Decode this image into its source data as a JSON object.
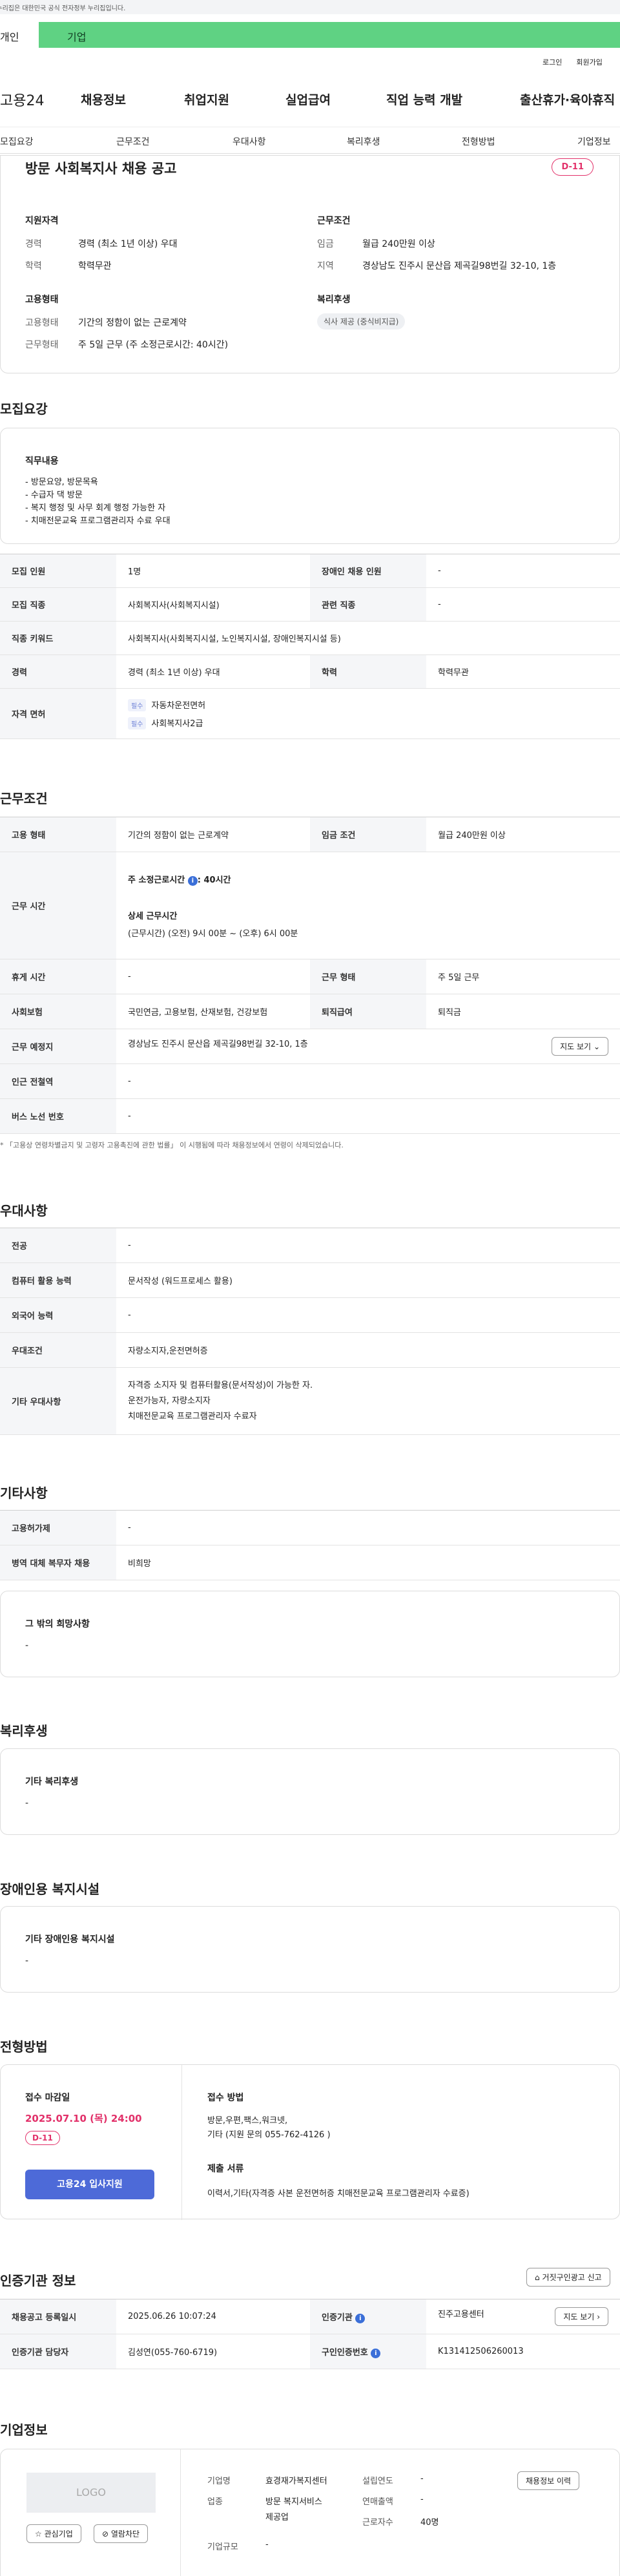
{
  "topbar": {
    "notice": "이 누리집은 대한민국 공식 전자정부 누리집입니다."
  },
  "site_tabs": {
    "personal": "개인",
    "corporate": "기업"
  },
  "util": {
    "login": "로그인",
    "join": "회원가입"
  },
  "gnb": {
    "logo": "고용24",
    "items": [
      "채용정보",
      "취업지원",
      "실업급여",
      "직업 능력 개발",
      "출산휴가·육아휴직"
    ]
  },
  "lnb": {
    "items": [
      "모집요강",
      "근무조건",
      "우대사항",
      "복리후생",
      "전형방법",
      "기업정보"
    ]
  },
  "header": {
    "title": "방문 사회복지사 채용 공고",
    "dday": "D-11",
    "qual_title": "지원자격",
    "career_label": "경력",
    "career_value": "경력 (최소 1년 이상) 우대",
    "edu_label": "학력",
    "edu_value": "학력무관",
    "emp_title": "고용형태",
    "emp_label": "고용형태",
    "emp_value": "기간의 정함이 없는 근로계약",
    "work_label": "근무형태",
    "work_value": "주 5일 근무 (주 소정근로시간: 40시간)",
    "cond_title": "근무조건",
    "wage_label": "임금",
    "wage_value": "월급 240만원 이상",
    "region_label": "지역",
    "region_value": "경상남도 진주시 문산읍 제곡길98번길 32-10, 1층",
    "welfare_title": "복리후생",
    "welfare_chip": "식사 제공 (중식비지급)"
  },
  "recruit": {
    "title": "모집요강",
    "duty_title": "직무내용",
    "duty_lines": [
      "- 방문요양, 방문목욕",
      "- 수급자 댁 방문",
      "- 복지 행정 및 사무 회계 행정 가능한 자",
      "- 치매전문교육 프로그램관리자 수료 우대"
    ],
    "headcount_label": "모집 인원",
    "headcount_value": "1명",
    "disabled_label": "장애인 채용 인원",
    "disabled_value": "-",
    "job_label": "모집 직종",
    "job_value": "사회복지사(사회복지시설)",
    "related_label": "관련 직종",
    "related_value": "-",
    "keyword_label": "직종 키워드",
    "keyword_value": "사회복지사(사회복지시설, 노인복지시설, 장애인복지시설 등)",
    "career_label": "경력",
    "career_value": "경력 (최소 1년 이상) 우대",
    "edu_label": "학력",
    "edu_value": "학력무관",
    "license_label": "자격 면허",
    "license_tag": "필수",
    "license_1": "자동차운전면허",
    "license_2": "사회복지사2급"
  },
  "work": {
    "title": "근무조건",
    "type_label": "고용 형태",
    "type_value": "기간의 정함이 없는 근로계약",
    "wage_label": "임금 조건",
    "wage_value": "월급 240만원 이상",
    "hours_label": "근무 시간",
    "hours_weekly_prefix": "주 소정근로시간",
    "hours_weekly_value": ": 40시간",
    "hours_detail_title": "상세 근무시간",
    "hours_detail": "(근무시간) (오전) 9시 00분 ~ (오후) 6시 00분",
    "rest_label": "휴게 시간",
    "rest_value": "-",
    "form_label": "근무 형태",
    "form_value": "주 5일 근무",
    "insurance_label": "사회보험",
    "insurance_value": "국민연금, 고용보험, 산재보험, 건강보험",
    "retire_label": "퇴직급여",
    "retire_value": "퇴직금",
    "place_label": "근무 예정지",
    "place_value": "경상남도 진주시 문산읍 제곡길98번길 32-10, 1층",
    "map_button": "지도 보기",
    "station_label": "인근 전철역",
    "station_value": "-",
    "bus_label": "버스 노선 번호",
    "bus_value": "-",
    "notice": "* 「고용상 연령차별금지 및 고령자 고용촉진에 관한 법률」 이 시행됨에 따라 채용정보에서 연령이 삭제되었습니다."
  },
  "pref": {
    "title": "우대사항",
    "major_label": "전공",
    "major_value": "-",
    "computer_label": "컴퓨터 활용 능력",
    "computer_value": "문서작성 (워드프로세스 활용)",
    "lang_label": "외국어 능력",
    "lang_value": "-",
    "cond_label": "우대조건",
    "cond_value": "자량소지자,운전면허증",
    "etc_label": "기타 우대사항",
    "etc_lines": [
      "자격증 소지자 및 컴퓨터활용(문서작성)이 가능한 자.",
      "운전가능자, 자량소지자",
      "치매전문교육 프로그램관리자 수료자"
    ]
  },
  "other": {
    "title": "기타사항",
    "ins_label": "고용허가제",
    "ins_value": "-",
    "mil_label": "병역 대체 복무자 채용",
    "mil_value": "비희망",
    "wish_title": "그 밖의 희망사항",
    "wish_value": "-"
  },
  "welfare": {
    "title": "복리후생",
    "box_title": "기타 복리후생",
    "box_value": "-"
  },
  "disabled": {
    "title": "장애인용 복지시설",
    "box_title": "기타 장애인용 복지시설",
    "box_value": "-"
  },
  "screening": {
    "title": "전형방법",
    "deadline_title": "접수 마감일",
    "deadline": "2025.07.10 (목) 24:00",
    "dday": "D-11",
    "apply_button": "고용24 입사지원",
    "method_title": "접수 방법",
    "method_line1": "방문,우편,팩스,워크넷,",
    "method_line2": "기타 (지원 문의 055-762-4126 )",
    "docs_title": "제출 서류",
    "docs_value": "이력서,기타(자격증 사본 운전면허증 치매전문교육 프로그램관리자 수료증)"
  },
  "cert": {
    "title": "인증기관 정보",
    "report_button": "거짓구인광고 신고",
    "reg_label": "채용공고 등록일시",
    "reg_value": "2025.06.26 10:07:24",
    "org_label": "인증기관",
    "org_value": "진주고용센터",
    "map_button": "지도 보기",
    "mgr_label": "인증기관 담당자",
    "mgr_value": "김성연(055-760-6719)",
    "no_label": "구인인증번호",
    "no_value": "K131412506260013"
  },
  "company": {
    "title": "기업정보",
    "logo_text": "LOGO",
    "fav_button": "관심기업",
    "block_button": "열람차단",
    "name_label": "기업명",
    "name_value": "효경재가복지센터",
    "industry_label": "업종",
    "industry_value1": "방문 복지서비스",
    "industry_value2": "제공업",
    "size_label": "기업규모",
    "size_value": "-",
    "founded_label": "설립연도",
    "founded_value": "-",
    "sales_label": "연매출액",
    "sales_value": "-",
    "staff_label": "근로자수",
    "staff_value": "40명",
    "history_button": "채용정보 이력"
  },
  "colors": {
    "accent_green": "#5fd283",
    "accent_blue": "#4d6ad8",
    "dday_red": "#e2316a"
  }
}
